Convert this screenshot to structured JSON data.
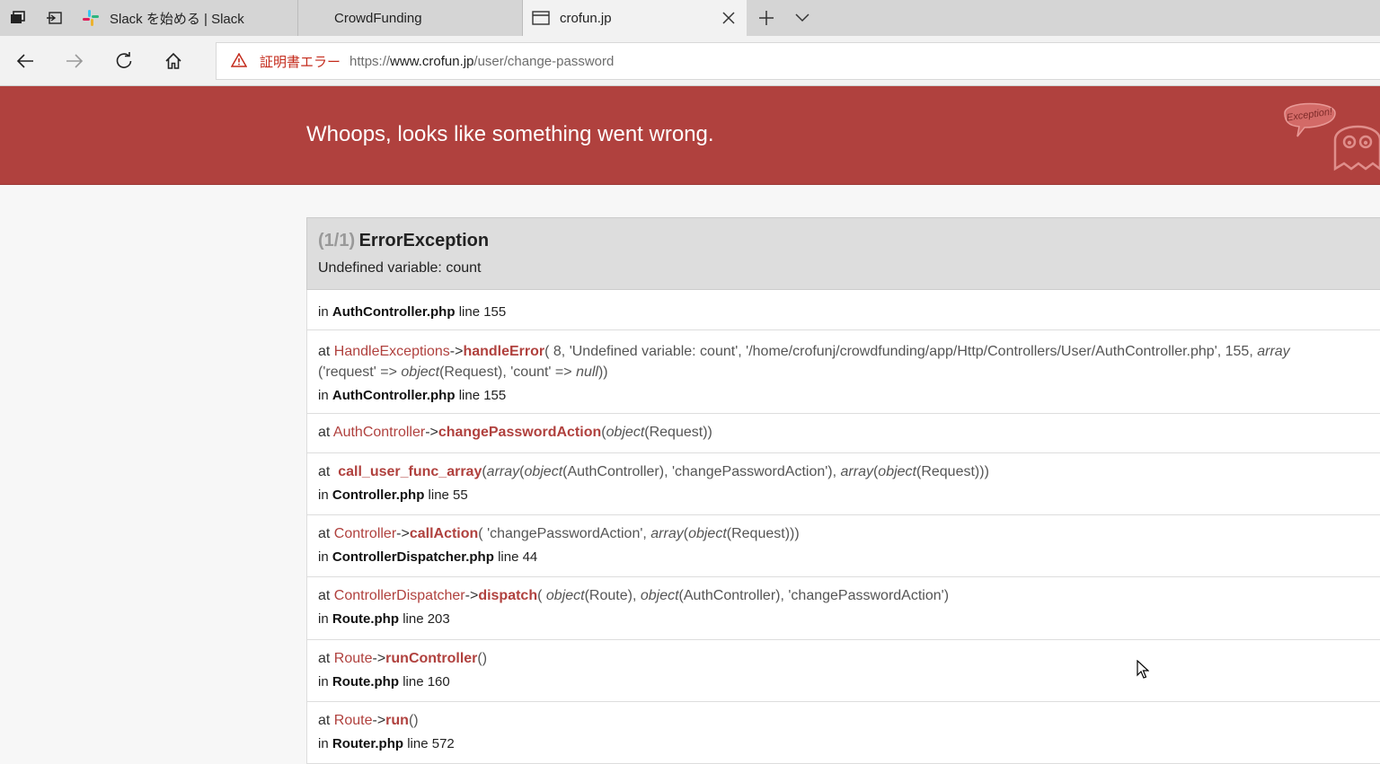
{
  "browser": {
    "tabs": [
      {
        "label": "Slack を始める | Slack",
        "icon": "slack-icon",
        "active": false
      },
      {
        "label": "CrowdFunding",
        "icon": "",
        "active": false
      },
      {
        "label": "crofun.jp",
        "icon": "page-icon",
        "active": true
      }
    ],
    "address": {
      "cert_error": "証明書エラー",
      "scheme": "https://",
      "host": "www.crofun.jp",
      "path": "/user/change-password"
    }
  },
  "page": {
    "header_title": "Whoops, looks like something went wrong.",
    "ghost_label": "Exception!",
    "exception": {
      "count": "(1/1)",
      "class": "ErrorException",
      "message": "Undefined variable: count"
    },
    "first_location": {
      "file": "AuthController.php",
      "line": "line 155"
    },
    "frames": [
      {
        "cls": "HandleExceptions",
        "arrow": "->",
        "fn": "handleError",
        "args1": "( 8, 'Undefined variable: count', '/home/crofunj/crowdfunding/app/Http/Controllers/User/AuthController.php', 155, ",
        "args1_italic": "array",
        "args2a": "('request' => ",
        "args2b_italic": "object",
        "args2c": "(Request), 'count' => ",
        "args2d_italic": "null",
        "args2e": "))",
        "file": "AuthController.php",
        "line": "line 155"
      },
      {
        "cls": "AuthController",
        "arrow": "->",
        "fn": "changePasswordAction",
        "args": "(",
        "args_i1": "object",
        "args_rest": "(Request))"
      },
      {
        "prefix": "at  ",
        "fn": "call_user_func_array",
        "a1": "(",
        "i1": "array",
        "a2": "(",
        "i2": "object",
        "a3": "(AuthController), 'changePasswordAction'), ",
        "i3": "array",
        "a4": "(",
        "i4": "object",
        "a5": "(Request)))",
        "file": "Controller.php",
        "line": "line 55"
      },
      {
        "cls": "Controller",
        "arrow": "->",
        "fn": "callAction",
        "a1": "( 'changePasswordAction', ",
        "i1": "array",
        "a2": "(",
        "i2": "object",
        "a3": "(Request)))",
        "file": "ControllerDispatcher.php",
        "line": "line 44"
      },
      {
        "cls": "ControllerDispatcher",
        "arrow": "->",
        "fn": "dispatch",
        "a1": "( ",
        "i1": "object",
        "a2": "(Route), ",
        "i2": "object",
        "a3": "(AuthController), 'changePasswordAction')",
        "file": "Route.php",
        "line": "line 203"
      },
      {
        "cls": "Route",
        "arrow": "->",
        "fn": "runController",
        "a1": "()",
        "file": "Route.php",
        "line": "line 160"
      },
      {
        "cls": "Route",
        "arrow": "->",
        "fn": "run",
        "a1": "()",
        "file": "Router.php",
        "line": "line 572"
      }
    ],
    "words": {
      "at": "at",
      "in": "in"
    }
  },
  "colors": {
    "header_red": "#b0413e",
    "link_red": "#b0413e",
    "panel_gray": "#dddddd"
  }
}
